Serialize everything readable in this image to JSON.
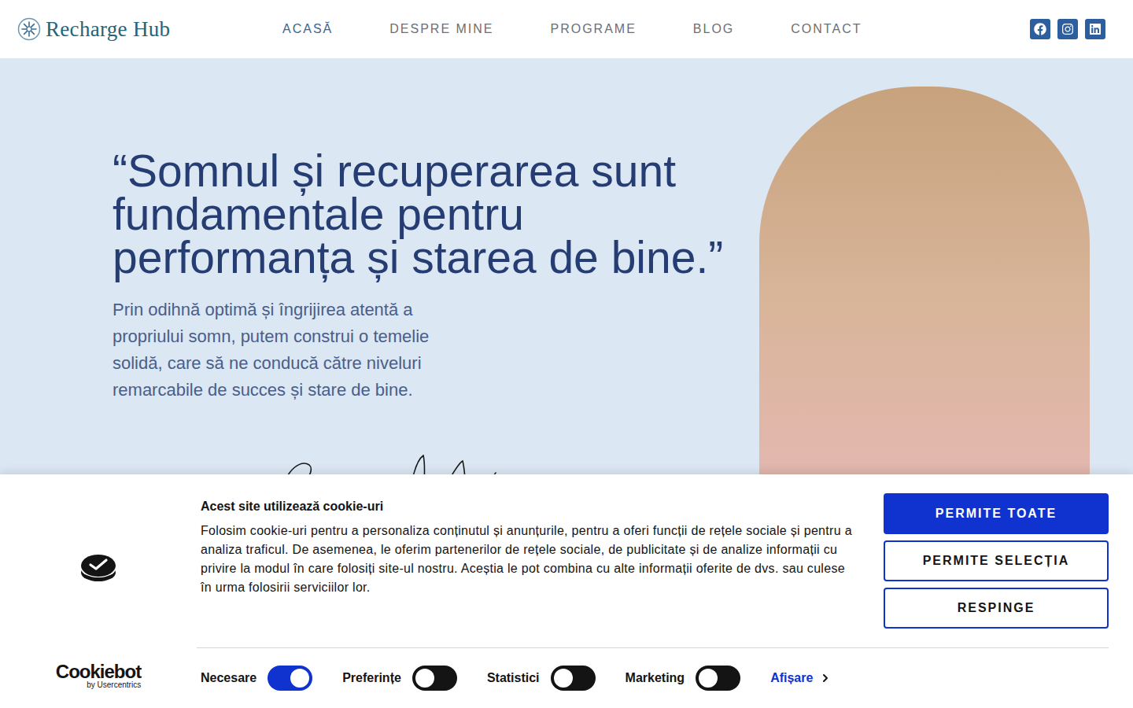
{
  "header": {
    "logo": "Recharge Hub",
    "nav": [
      {
        "label": "ACASĂ",
        "selected": true
      },
      {
        "label": "DESPRE MINE",
        "selected": false
      },
      {
        "label": "PROGRAME",
        "selected": false
      },
      {
        "label": "BLOG",
        "selected": false
      },
      {
        "label": "CONTACT",
        "selected": false
      }
    ]
  },
  "hero": {
    "quote_lines": [
      "“Somnul și recuperarea sunt",
      "fundamentale pentru",
      "performanța și starea de bine.”"
    ],
    "text": "Prin odihnă optimă și îngrijirea atentă a propriului somn, putem construi o temelie solidă, care să ne conducă către niveluri remarcabile de succes și stare de bine."
  },
  "cookie_banner": {
    "brand": "Cookiebot",
    "brand_sub": "by Usercentrics",
    "title": "Acest site utilizează cookie-uri",
    "body": "Folosim cookie-uri pentru a personaliza conținutul și anunțurile, pentru a oferi funcții de rețele sociale și pentru a analiza traficul. De asemenea, le oferim partenerilor de rețele sociale, de publicitate și de analize informații cu privire la modul în care folosiți site-ul nostru. Aceștia le pot combina cu alte informații oferite de dvs. sau culese în urma folosirii serviciilor lor.",
    "buttons": [
      {
        "label": "PERMITE TOATE",
        "kind": "primary"
      },
      {
        "label": "PERMITE SELECȚIA",
        "kind": "outline"
      },
      {
        "label": "RESPINGE",
        "kind": "outline"
      }
    ],
    "toggles": [
      {
        "label": "Necesare",
        "on": true
      },
      {
        "label": "Preferințe",
        "on": false
      },
      {
        "label": "Statistici",
        "on": false
      },
      {
        "label": "Marketing",
        "on": false
      }
    ],
    "details_link": "Afișare"
  }
}
